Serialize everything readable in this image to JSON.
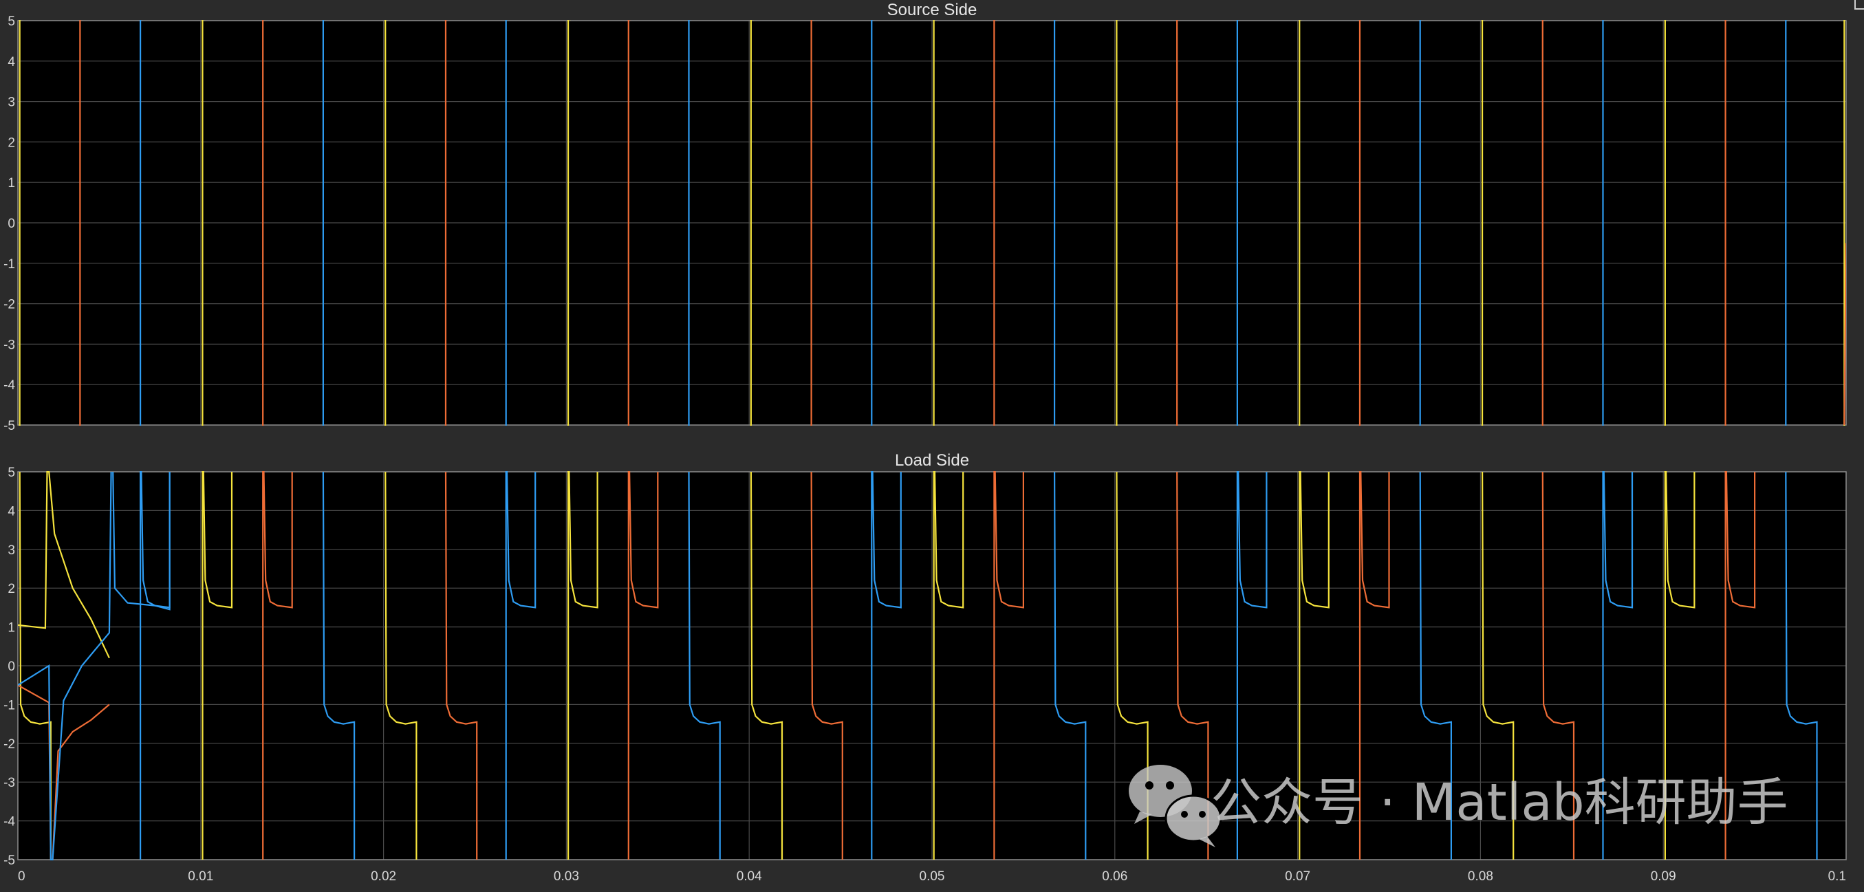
{
  "colors": {
    "background": "#2b2b2b",
    "plot_background": "#000000",
    "grid": "#4a4a4a",
    "axis_text": "#d8d8d8",
    "series_yellow": "#f5e33d",
    "series_orange": "#ee6c36",
    "series_blue": "#2e9cf2"
  },
  "watermark": {
    "text": "公众号 · Matlab科研助手",
    "icon": "wechat-icon"
  },
  "chart_data": [
    {
      "type": "line",
      "title": "Source Side",
      "xlabel": "",
      "ylabel": "",
      "xlim": [
        0,
        0.1
      ],
      "ylim": [
        -5,
        5
      ],
      "grid": true,
      "x_ticks": [
        "0",
        "0.01",
        "0.02",
        "0.03",
        "0.04",
        "0.05",
        "0.06",
        "0.07",
        "0.08",
        "0.09",
        "0.1"
      ],
      "y_ticks": [
        "5",
        "4",
        "3",
        "2",
        "1",
        "0",
        "-1",
        "-2",
        "-3",
        "-4",
        "-5"
      ],
      "period": 0.01,
      "series": [
        {
          "color": "series_yellow",
          "description": "pulse train, rises at phase offset, clipped at ±5",
          "transitions": [
            0.0001,
            0.0101,
            0.0201,
            0.0301,
            0.0401,
            0.0501,
            0.0601,
            0.0701,
            0.0801,
            0.0901,
            0.0999
          ]
        },
        {
          "color": "series_orange",
          "transitions": [
            0.0034,
            0.0134,
            0.0234,
            0.0334,
            0.0434,
            0.0534,
            0.0634,
            0.0734,
            0.0834,
            0.0934
          ]
        },
        {
          "color": "series_blue",
          "transitions": [
            0.0067,
            0.0167,
            0.0267,
            0.0367,
            0.0467,
            0.0567,
            0.0667,
            0.0767,
            0.0867,
            0.0967
          ]
        }
      ]
    },
    {
      "type": "line",
      "title": "Load Side",
      "xlabel": "",
      "ylabel": "",
      "xlim": [
        0,
        0.1
      ],
      "ylim": [
        -5,
        5
      ],
      "grid": true,
      "x_ticks": [
        "0",
        "0.01",
        "0.02",
        "0.03",
        "0.04",
        "0.05",
        "0.06",
        "0.07",
        "0.08",
        "0.09",
        "0.1"
      ],
      "y_ticks": [
        "5",
        "4",
        "3",
        "2",
        "1",
        "0",
        "-1",
        "-2",
        "-3",
        "-4",
        "-5"
      ],
      "period": 0.01,
      "plateau_high": 1.5,
      "plateau_low": -1.5,
      "series": [
        {
          "color": "series_yellow",
          "start": [
            [
              0,
              1.05
            ],
            [
              0.0015,
              0.97
            ],
            [
              0.0016,
              5
            ],
            [
              0.0017,
              5
            ],
            [
              0.002,
              3.4
            ],
            [
              0.003,
              2.0
            ],
            [
              0.004,
              1.2
            ],
            [
              0.005,
              0.2
            ]
          ],
          "rises": [
            0.0001,
            0.0101,
            0.0201,
            0.0301,
            0.0401,
            0.0501,
            0.0601,
            0.0701,
            0.0801,
            0.0901
          ],
          "high_end": [
            0.0101,
            0.0201,
            0.0301,
            0.0401,
            0.0501,
            0.0601,
            0.0701,
            0.0801,
            0.0901
          ],
          "low_plateau_start": [
            0.0101,
            0.0301,
            0.0501,
            0.0701,
            0.0901
          ],
          "low_plateau_end": [
            0.0118,
            0.0318,
            0.0518,
            0.0718,
            0.0918
          ],
          "high_plateau_start": [
            0.0201,
            0.0401,
            0.0601,
            0.0801
          ],
          "high_plateau_end": [
            0.0218,
            0.0418,
            0.0618,
            0.0818
          ]
        },
        {
          "color": "series_orange",
          "start": [
            [
              0,
              -0.5
            ],
            [
              0.0017,
              -0.95
            ],
            [
              0.0018,
              -5
            ],
            [
              0.0019,
              -5
            ],
            [
              0.0022,
              -2.2
            ],
            [
              0.003,
              -1.7
            ],
            [
              0.004,
              -1.4
            ],
            [
              0.005,
              -1.0
            ]
          ],
          "rises": [
            0.0134,
            0.0234,
            0.0334,
            0.0434,
            0.0534,
            0.0634,
            0.0734,
            0.0834,
            0.0934
          ]
        },
        {
          "color": "series_blue",
          "start": [
            [
              0,
              -0.5
            ],
            [
              0.0017,
              0.0
            ],
            [
              0.0018,
              -5
            ],
            [
              0.0019,
              -5
            ],
            [
              0.0025,
              -0.9
            ],
            [
              0.0035,
              0.0
            ],
            [
              0.005,
              0.85
            ],
            [
              0.0051,
              5
            ]
          ],
          "rises": [
            0.0067,
            0.0167,
            0.0267,
            0.0367,
            0.0467,
            0.0567,
            0.0667,
            0.0767,
            0.0867,
            0.0967
          ]
        }
      ]
    }
  ]
}
